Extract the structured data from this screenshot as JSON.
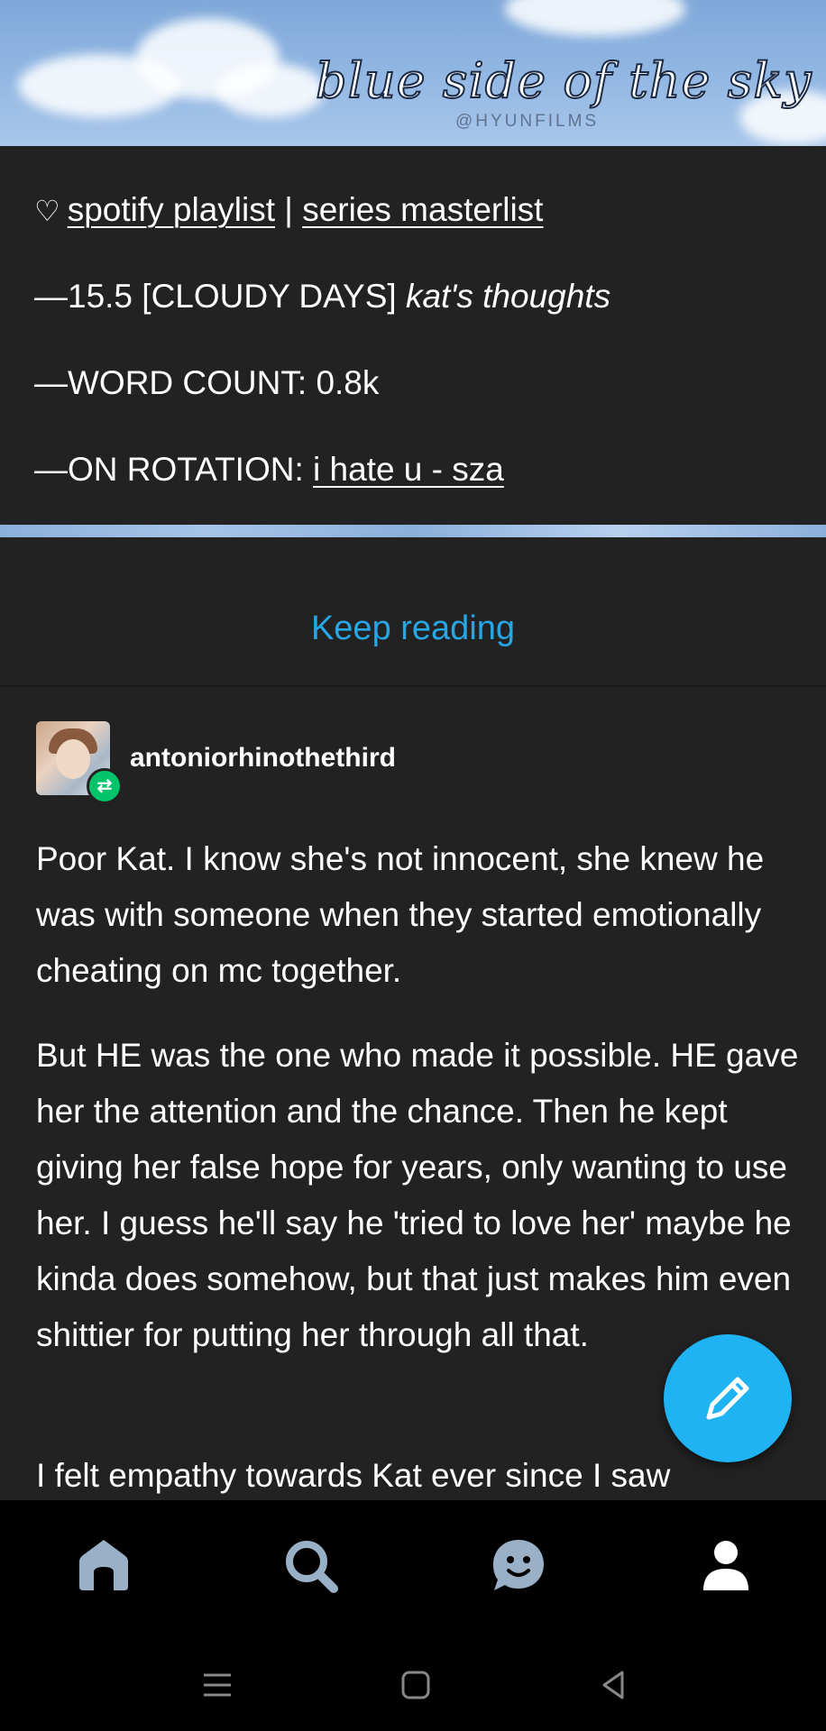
{
  "banner": {
    "title": "blue side of the sky",
    "handle": "@HYUNFILMS"
  },
  "info": {
    "heart": "♡",
    "playlist_link": "spotify playlist",
    "separator": "|",
    "masterlist_link": "series masterlist",
    "chapter_prefix": "—15.5 [CLOUDY DAYS]",
    "chapter_title": "kat's thoughts",
    "word_count_label": "—WORD COUNT:",
    "word_count_value": "0.8k",
    "rotation_label": "—ON ROTATION:",
    "rotation_value": "i hate u - sza"
  },
  "keep_reading": "Keep reading",
  "reblogger": {
    "username": "antoniorhinothethird",
    "badge": "⇄"
  },
  "post": {
    "paragraphs": [
      "Poor Kat. I know she's not innocent, she knew he was with someone when they started emotionally cheating on mc together.",
      "But HE was the one who made it possible. HE gave her the attention and the chance. Then he kept giving her false hope for years, only wanting to use her. I guess he'll say he 'tried to love her' maybe he kinda does somehow, but that just makes him even shittier for putting her through all that.",
      "I felt empathy towards Kat ever since I saw"
    ]
  },
  "fab": {
    "icon": "pencil-icon"
  },
  "bottom_nav": [
    {
      "name": "home",
      "icon": "home-icon"
    },
    {
      "name": "search",
      "icon": "search-icon"
    },
    {
      "name": "activity",
      "icon": "chat-smile-icon"
    },
    {
      "name": "account",
      "icon": "person-icon"
    }
  ],
  "system_nav": [
    {
      "name": "recents",
      "icon": "recents-icon"
    },
    {
      "name": "home",
      "icon": "home-square-icon"
    },
    {
      "name": "back",
      "icon": "back-icon"
    }
  ],
  "colors": {
    "accent": "#27a6e5",
    "fab": "#1fb3f3",
    "reblog_badge": "#00c46a",
    "background": "#222222",
    "nav_icon": "#9ab0c6"
  }
}
